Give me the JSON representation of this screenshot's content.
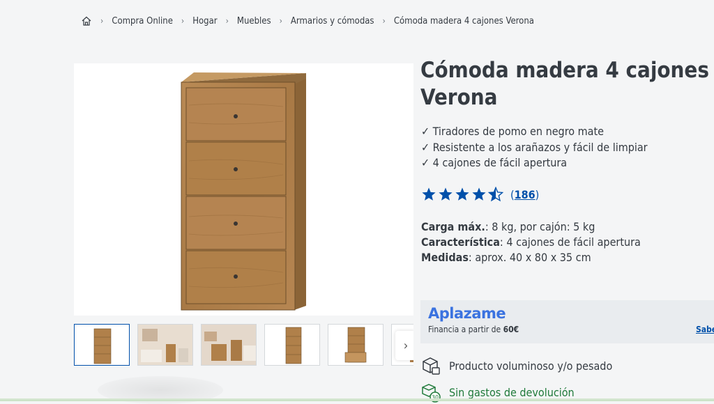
{
  "breadcrumb": {
    "items": [
      "Compra Online",
      "Hogar",
      "Muebles",
      "Armarios y cómodas",
      "Cómoda madera 4 cajones Verona"
    ]
  },
  "product": {
    "title": "Cómoda madera 4 cajones Verona",
    "features": [
      "✓ Tiradores de pomo en negro mate",
      "✓ Resistente a los arañazos y fácil de limpiar",
      "✓ 4 cajones de fácil apertura"
    ],
    "rating": {
      "value": 4.5,
      "max": 5,
      "count": "186"
    },
    "specs": [
      {
        "label": "Carga máx.",
        "value": ": 8 kg, por cajón: 5 kg"
      },
      {
        "label": "Característica",
        "value": ": 4 cajones de fácil apertura"
      },
      {
        "label": "Medidas",
        "value": ": aprox. 40 x 80 x 35 cm"
      }
    ]
  },
  "financing": {
    "brand": "Aplazame",
    "text_prefix": "Financia a partir de ",
    "amount": "60€",
    "link": "Saber"
  },
  "info": {
    "bulky": "Producto voluminoso y/o pesado",
    "returns": "Sin gastos de devolución",
    "returns_days": "30"
  },
  "gallery": {
    "next_icon": "chevron-right-icon"
  },
  "colors": {
    "accent": "#0050aa",
    "text": "#353b42",
    "star": "#0050aa",
    "finance_brand": "#3b73e0",
    "green": "#1f7a3a"
  }
}
